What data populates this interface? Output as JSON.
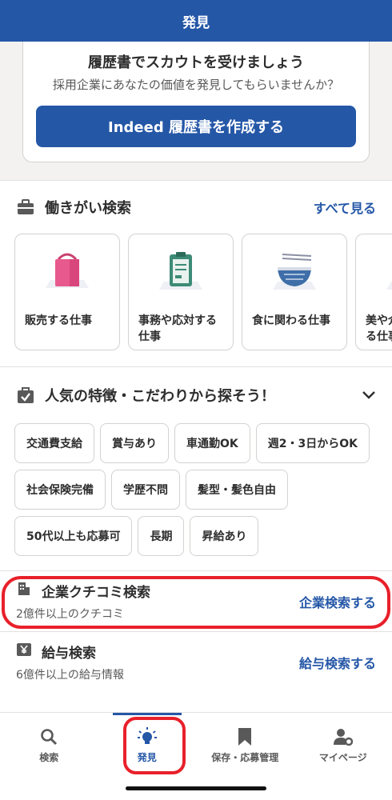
{
  "header": {
    "title": "発見"
  },
  "resume": {
    "title": "履歴書でスカウトを受けましょう",
    "subtitle": "採用企業にあなたの価値を発見してもらいませんか？",
    "button": "Indeed 履歴書を作成する"
  },
  "work_style": {
    "title": "働きがい検索",
    "see_all": "すべて見る",
    "cards": [
      {
        "label": "販売する仕事",
        "icon": "shopping-bag-icon"
      },
      {
        "label": "事務や応対する仕事",
        "icon": "clipboard-icon"
      },
      {
        "label": "食に関わる仕事",
        "icon": "noodle-bowl-icon"
      },
      {
        "label": "美や介護に関わる仕事",
        "icon": "beauty-icon"
      }
    ]
  },
  "features": {
    "title": "人気の特徴・こだわりから探そう！",
    "chips": [
      "交通費支給",
      "賞与あり",
      "車通勤OK",
      "週2・3日からOK",
      "社会保険完備",
      "学歴不問",
      "髪型・髪色自由",
      "50代以上も応募可",
      "長期",
      "昇給あり"
    ]
  },
  "company_search": {
    "title": "企業クチコミ検索",
    "subtitle": "2億件以上のクチコミ",
    "action": "企業検索する"
  },
  "salary_search": {
    "title": "給与検索",
    "subtitle": "6億件以上の給与情報",
    "action": "給与検索する"
  },
  "tabs": [
    {
      "label": "検索",
      "icon": "search-icon"
    },
    {
      "label": "発見",
      "icon": "lightbulb-icon"
    },
    {
      "label": "保存・応募管理",
      "icon": "bookmark-icon"
    },
    {
      "label": "マイページ",
      "icon": "profile-settings-icon"
    }
  ],
  "colors": {
    "brand": "#2557a7",
    "highlight": "#e8202a"
  }
}
